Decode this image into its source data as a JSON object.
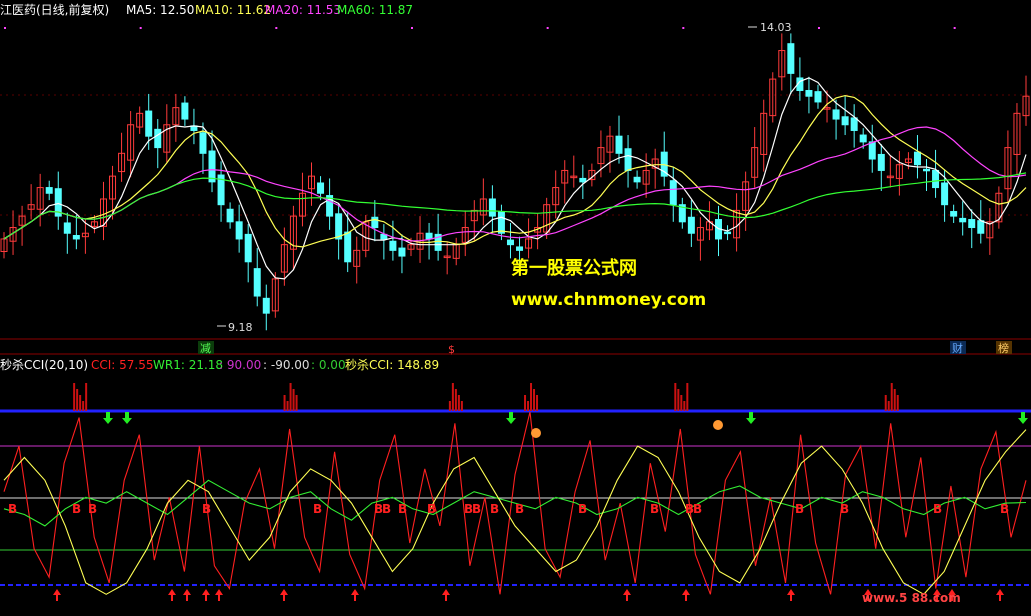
{
  "colors": {
    "background": "#000000",
    "up": "#ff3b3b",
    "down": "#55ffff",
    "ma5": "#ffffff",
    "ma10": "#ffff55",
    "ma20": "#ff44ff",
    "ma60": "#33ff33",
    "cci": "#ff2020",
    "wr": "#33ee33",
    "miaosha": "#ffff55",
    "line_top": "#3333ff",
    "line_mag": "#cc33cc",
    "line_white": "#dddddd",
    "line_green": "#33cc33",
    "watermark": "#ffff00"
  },
  "header": {
    "title": "江医药(日线,前复权)",
    "ma5_label": "MA5: 12.50",
    "ma10_label": "MA10: 11.62",
    "ma20_label": "MA20: 11.53",
    "ma60_label": "MA60: 11.87"
  },
  "indicator_header": {
    "name": "秒杀CCI(20,10)",
    "cci_label": "CCI: 57.55",
    "wr_label": "WR1: 21.18",
    "level_90": ": 90.00",
    "level_m90": ": -90.00",
    "level_0": ": 0.00",
    "msc_label": "秒杀CCI: 148.89"
  },
  "annotations": {
    "high_label": "14.03",
    "low_label": "9.18",
    "event_jian": "减",
    "event_s": "$",
    "event_cai": "财",
    "event_bang": "榜"
  },
  "watermark": {
    "line1": "第一股票公式网",
    "line2": "www.chnmoney.com",
    "corner": "www.5 88.com"
  },
  "buy_marker": "B",
  "chart_data": [
    {
      "type": "candlestick",
      "title": "江医药(日线,前复权)",
      "ylim": [
        8.9,
        14.4
      ],
      "high": 14.03,
      "low": 9.18,
      "ma_latest": {
        "MA5": 12.5,
        "MA10": 11.62,
        "MA20": 11.53,
        "MA60": 11.87
      },
      "closes": [
        10.6,
        10.8,
        11.0,
        11.2,
        11.5,
        11.4,
        11.0,
        10.7,
        10.6,
        10.7,
        10.9,
        11.3,
        11.7,
        12.1,
        12.6,
        12.8,
        12.4,
        12.2,
        12.6,
        12.9,
        12.7,
        12.5,
        12.1,
        11.6,
        11.2,
        10.9,
        10.6,
        10.2,
        9.6,
        9.3,
        9.9,
        10.5,
        11.0,
        11.4,
        11.7,
        11.4,
        11.0,
        10.6,
        10.2,
        10.4,
        10.9,
        10.8,
        10.6,
        10.4,
        10.3,
        10.5,
        10.7,
        10.6,
        10.4,
        10.3,
        10.5,
        10.8,
        11.1,
        11.3,
        11.0,
        10.7,
        10.5,
        10.4,
        10.6,
        10.8,
        11.2,
        11.5,
        11.8,
        11.7,
        11.6,
        11.8,
        12.2,
        12.4,
        12.1,
        11.8,
        11.6,
        11.8,
        12.0,
        11.7,
        11.2,
        10.9,
        10.7,
        10.8,
        10.9,
        10.6,
        10.7,
        11.1,
        11.6,
        12.2,
        12.8,
        13.4,
        13.9,
        13.5,
        13.2,
        13.1,
        13.0,
        12.9,
        12.7,
        12.6,
        12.5,
        12.3,
        12.0,
        11.8,
        11.7,
        11.9,
        12.0,
        11.9,
        11.8,
        11.5,
        11.2,
        11.0,
        10.9,
        10.8,
        10.7,
        10.9,
        11.4,
        12.2,
        12.8,
        13.1
      ],
      "volume_unit": "元",
      "overlays": [
        "MA5",
        "MA10",
        "MA20",
        "MA60"
      ]
    },
    {
      "type": "line",
      "title": "秒杀CCI(20,10)",
      "ylim": [
        -150,
        250
      ],
      "levels": [
        90,
        -90,
        0
      ],
      "series": [
        {
          "name": "CCI",
          "values": [
            40,
            120,
            -60,
            -110,
            90,
            170,
            -40,
            -120,
            60,
            140,
            -80,
            30,
            -100,
            120,
            -90,
            -130,
            20,
            80,
            -60,
            150,
            -40,
            -100,
            110,
            -70,
            -130,
            60,
            140,
            -50,
            80,
            -20,
            160,
            -90,
            30,
            -140,
            70,
            180,
            -60,
            -110,
            40,
            130,
            -80,
            20,
            -120,
            90,
            -30,
            150,
            -70,
            -140,
            60,
            110,
            -90,
            30,
            -120,
            140,
            -50,
            -140,
            70,
            120,
            -60,
            160,
            -40,
            100,
            -130,
            50,
            -110,
            80,
            145,
            -40,
            60
          ]
        },
        {
          "name": "WR1",
          "values": [
            10,
            0,
            -20,
            10,
            30,
            20,
            40,
            20,
            0,
            30,
            60,
            40,
            20,
            10,
            30,
            40,
            10,
            -10,
            20,
            30,
            10,
            0,
            20,
            40,
            30,
            20,
            10,
            30,
            20,
            0,
            10,
            30,
            20,
            0,
            20,
            40,
            50,
            30,
            20,
            10,
            30,
            20,
            40,
            30,
            10,
            0,
            20,
            30,
            10,
            20,
            21
          ]
        },
        {
          "name": "秒杀CCI",
          "values": [
            60,
            100,
            60,
            -20,
            -120,
            -140,
            -120,
            -60,
            20,
            60,
            40,
            -20,
            -80,
            -40,
            40,
            80,
            60,
            20,
            -40,
            -100,
            -60,
            20,
            80,
            100,
            40,
            -20,
            -60,
            -100,
            -80,
            -20,
            60,
            120,
            100,
            40,
            -40,
            -100,
            -120,
            -60,
            20,
            90,
            120,
            80,
            20,
            -60,
            -120,
            -140,
            -100,
            -20,
            60,
            110,
            149
          ]
        }
      ]
    }
  ]
}
